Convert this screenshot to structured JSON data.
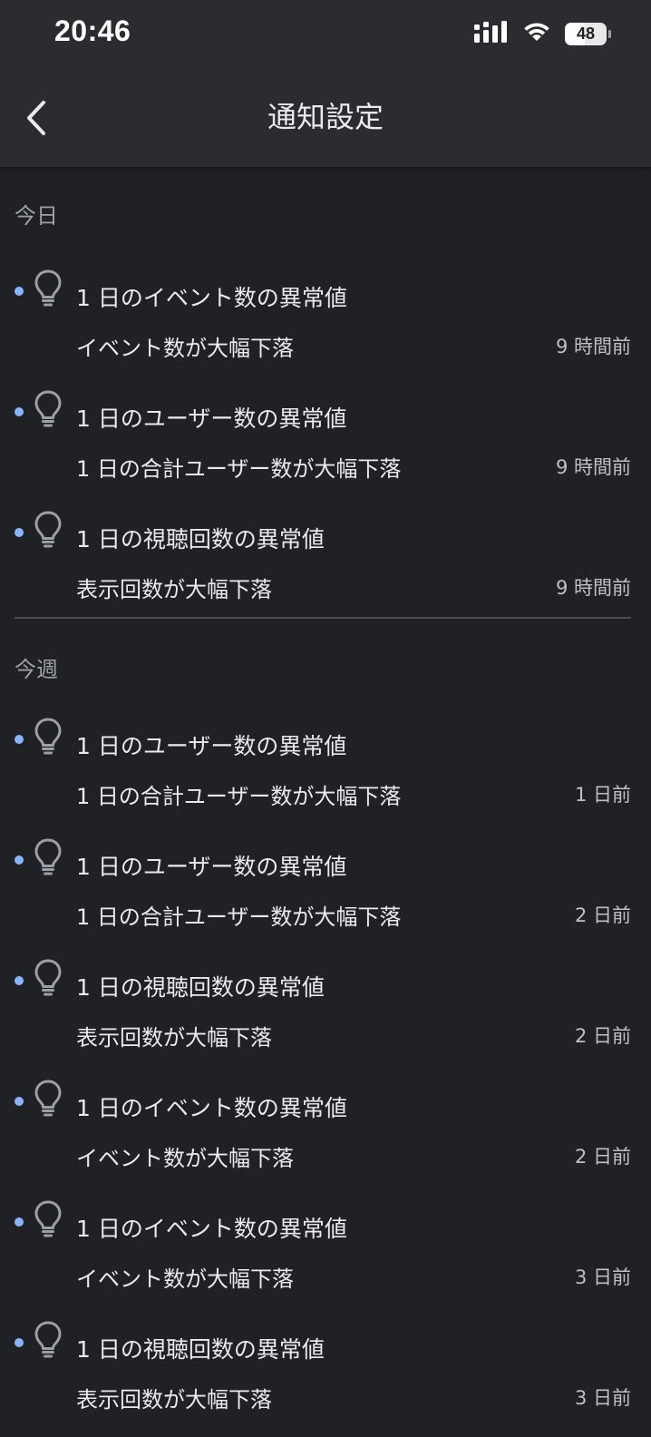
{
  "status_bar": {
    "time": "20:46",
    "battery": 48
  },
  "header": {
    "title": "通知設定",
    "back_icon": "chevron-left-icon"
  },
  "colors": {
    "background": "#202124",
    "header_background": "#2b2c30",
    "unread_dot": "#8ab4f8",
    "icon_gray": "#9aa0a6",
    "divider": "#4a4c50"
  },
  "sections": [
    {
      "label": "今日",
      "items": [
        {
          "title": "1 日のイベント数の異常値",
          "description": "イベント数が大幅下落",
          "time": "9 時間前",
          "icon": "lightbulb-icon",
          "unread": true
        },
        {
          "title": "1 日のユーザー数の異常値",
          "description": "1 日の合計ユーザー数が大幅下落",
          "time": "9 時間前",
          "icon": "lightbulb-icon",
          "unread": true
        },
        {
          "title": "1 日の視聴回数の異常値",
          "description": "表示回数が大幅下落",
          "time": "9 時間前",
          "icon": "lightbulb-icon",
          "unread": true
        }
      ]
    },
    {
      "label": "今週",
      "items": [
        {
          "title": "1 日のユーザー数の異常値",
          "description": "1 日の合計ユーザー数が大幅下落",
          "time": "1 日前",
          "icon": "lightbulb-icon",
          "unread": true
        },
        {
          "title": "1 日のユーザー数の異常値",
          "description": "1 日の合計ユーザー数が大幅下落",
          "time": "2 日前",
          "icon": "lightbulb-icon",
          "unread": true
        },
        {
          "title": "1 日の視聴回数の異常値",
          "description": "表示回数が大幅下落",
          "time": "2 日前",
          "icon": "lightbulb-icon",
          "unread": true
        },
        {
          "title": "1 日のイベント数の異常値",
          "description": "イベント数が大幅下落",
          "time": "2 日前",
          "icon": "lightbulb-icon",
          "unread": true
        },
        {
          "title": "1 日のイベント数の異常値",
          "description": "イベント数が大幅下落",
          "time": "3 日前",
          "icon": "lightbulb-icon",
          "unread": true
        },
        {
          "title": "1 日の視聴回数の異常値",
          "description": "表示回数が大幅下落",
          "time": "3 日前",
          "icon": "lightbulb-icon",
          "unread": true
        }
      ]
    }
  ]
}
